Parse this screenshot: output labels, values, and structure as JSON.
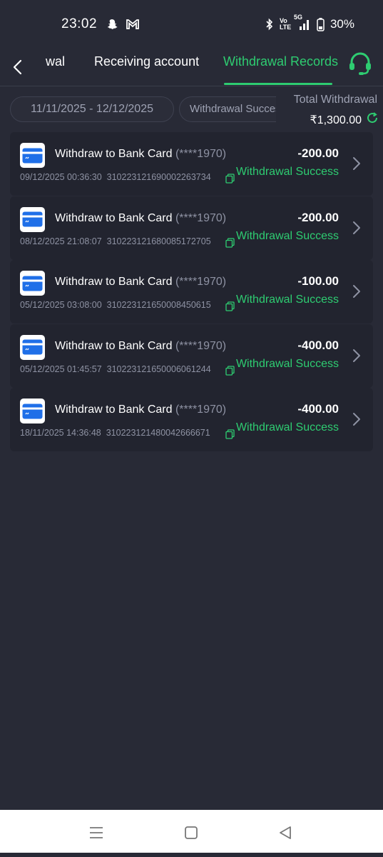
{
  "status_bar": {
    "time": "23:02",
    "network": "5G",
    "volte": "Vo LTE",
    "battery": "30%"
  },
  "nav": {
    "tabs": [
      "wal",
      "Receiving account",
      "Withdrawal Records"
    ],
    "active_tab": "Withdrawal Records"
  },
  "filters": {
    "date_range": "11/11/2025 - 12/12/2025",
    "status": "Withdrawal Success",
    "total_label": "Total Withdrawal",
    "total_amount": "₹1,300.00"
  },
  "records": [
    {
      "title": "Withdraw to Bank Card",
      "card": "(****1970)",
      "datetime": "09/12/2025 00:36:30",
      "order_id": "310223121690002263734",
      "amount": "-200.00",
      "status": "Withdrawal Success"
    },
    {
      "title": "Withdraw to Bank Card",
      "card": "(****1970)",
      "datetime": "08/12/2025 21:08:07",
      "order_id": "310223121680085172705",
      "amount": "-200.00",
      "status": "Withdrawal Success"
    },
    {
      "title": "Withdraw to Bank Card",
      "card": "(****1970)",
      "datetime": "05/12/2025 03:08:00",
      "order_id": "310223121650008450615",
      "amount": "-100.00",
      "status": "Withdrawal Success"
    },
    {
      "title": "Withdraw to Bank Card",
      "card": "(****1970)",
      "datetime": "05/12/2025 01:45:57",
      "order_id": "310223121650006061244",
      "amount": "-400.00",
      "status": "Withdrawal Success"
    },
    {
      "title": "Withdraw to Bank Card",
      "card": "(****1970)",
      "datetime": "18/11/2025 14:36:48",
      "order_id": "310223121480042666671",
      "amount": "-400.00",
      "status": "Withdrawal Success"
    }
  ],
  "colors": {
    "background": "#282a36",
    "card_background": "#22242f",
    "accent_green": "#2ecc71",
    "muted_text": "#8e92a3",
    "bank_icon_blue": "#1f6fe8"
  },
  "icons": [
    "back-arrow-icon",
    "headset-support-icon",
    "refresh-icon",
    "bank-card-icon",
    "copy-icon",
    "chevron-right-icon",
    "menu-icon",
    "home-square-icon",
    "back-triangle-icon"
  ]
}
